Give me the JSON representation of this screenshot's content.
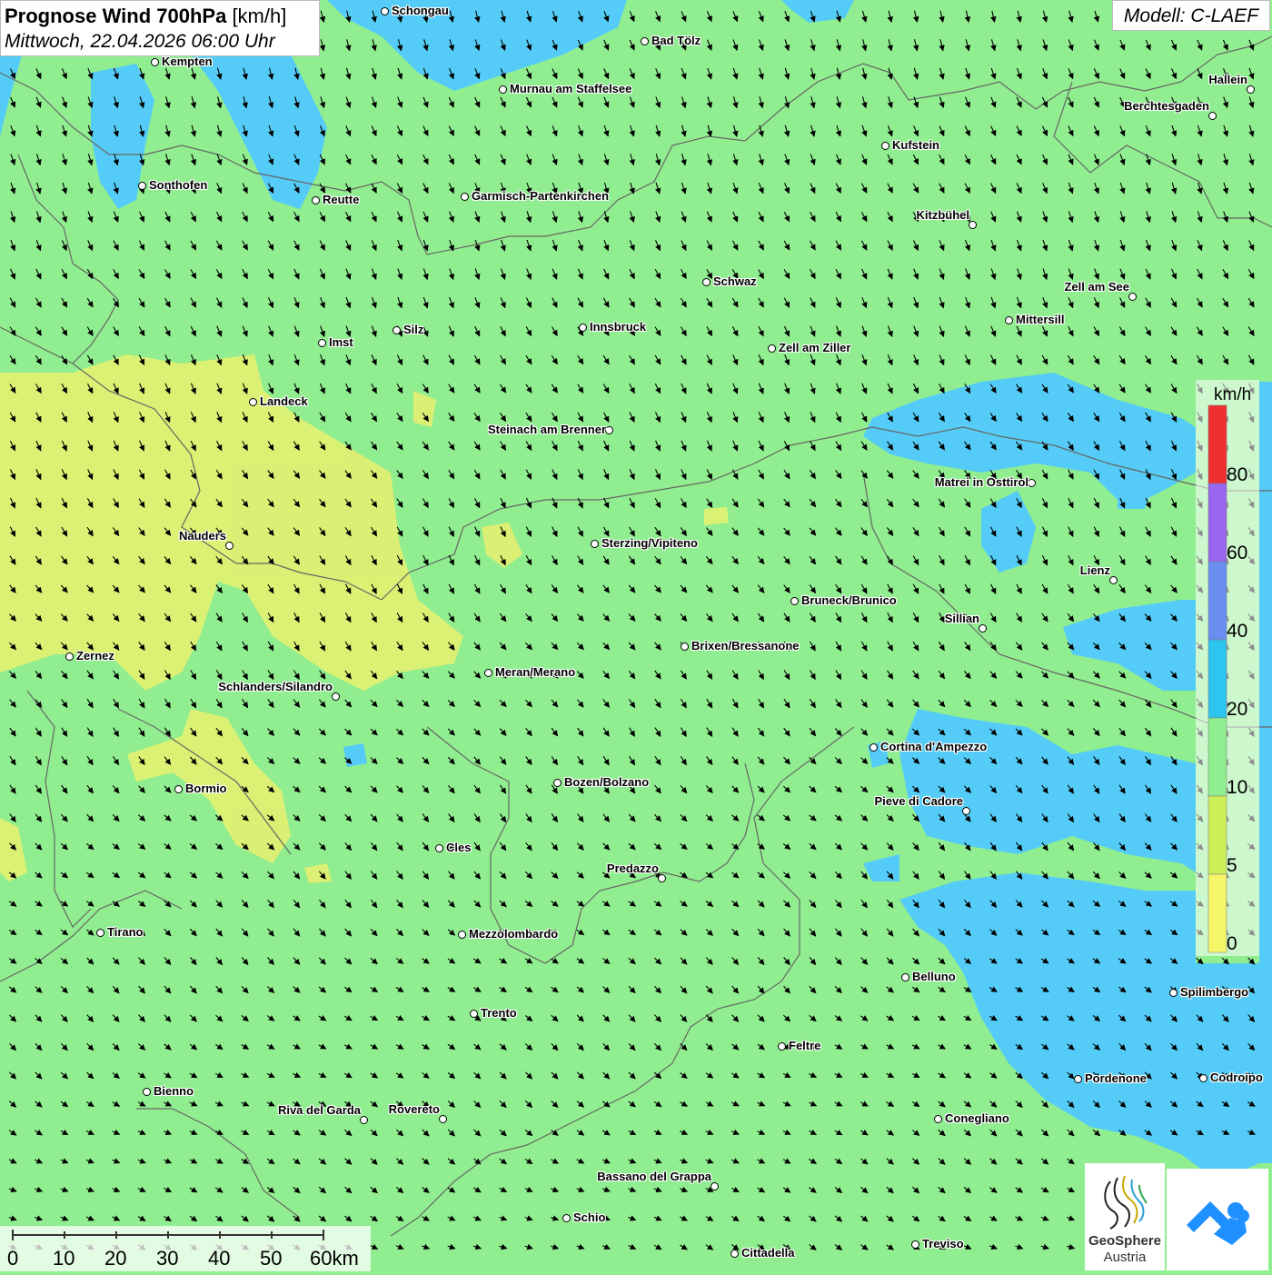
{
  "title": {
    "bold": "Prognose Wind 700hPa",
    "unit": "[km/h]",
    "datetime": "Mittwoch, 22.04.2026 06:00 Uhr"
  },
  "model": "Modell: C-LAEF",
  "colors": {
    "speed_0_5": "#f5f56a",
    "speed_5_10": "#cdef5a",
    "speed_10_20": "#90ee90",
    "speed_20_40": "#55ccf7",
    "speed_40_60": "#6a8ef0",
    "speed_60_80": "#9966ee",
    "speed_80_plus": "#f03030",
    "border_line": "#666666"
  },
  "legend": {
    "unit": "km/h",
    "labels": [
      "0",
      "5",
      "10",
      "20",
      "40",
      "60",
      "80"
    ]
  },
  "scale": {
    "labels": [
      "0",
      "10",
      "20",
      "30",
      "40",
      "50",
      "60km"
    ]
  },
  "logo": {
    "line1": "GeoSphere",
    "line2": "Austria"
  },
  "cities": [
    {
      "name": "Schongau"
    },
    {
      "name": "Bad Tölz"
    },
    {
      "name": "Kempten"
    },
    {
      "name": "Murnau am Staffelsee"
    },
    {
      "name": "Hallein"
    },
    {
      "name": "Berchtesgaden"
    },
    {
      "name": "Kufstein"
    },
    {
      "name": "Sonthofen"
    },
    {
      "name": "Reutte"
    },
    {
      "name": "Garmisch-Partenkirchen"
    },
    {
      "name": "Kitzbühel"
    },
    {
      "name": "Schwaz"
    },
    {
      "name": "Zell am See"
    },
    {
      "name": "Mittersill"
    },
    {
      "name": "Silz"
    },
    {
      "name": "Innsbruck"
    },
    {
      "name": "Imst"
    },
    {
      "name": "Zell am Ziller"
    },
    {
      "name": "Landeck"
    },
    {
      "name": "Steinach am Brenner"
    },
    {
      "name": "Matrei in Osttirol"
    },
    {
      "name": "Nauders"
    },
    {
      "name": "Sterzing/Vipiteno"
    },
    {
      "name": "Lienz"
    },
    {
      "name": "Bruneck/Brunico"
    },
    {
      "name": "Sillian"
    },
    {
      "name": "Brixen/Bressanone"
    },
    {
      "name": "Zernez"
    },
    {
      "name": "Meran/Merano"
    },
    {
      "name": "Schlanders/Silandro"
    },
    {
      "name": "Cortina d'Ampezzo"
    },
    {
      "name": "Bozen/Bolzano"
    },
    {
      "name": "Bormio"
    },
    {
      "name": "Pieve di Cadore"
    },
    {
      "name": "Cles"
    },
    {
      "name": "Predazzo"
    },
    {
      "name": "Tirano"
    },
    {
      "name": "Mezzolombardo"
    },
    {
      "name": "Belluno"
    },
    {
      "name": "Spilimbergo"
    },
    {
      "name": "Trento"
    },
    {
      "name": "Feltre"
    },
    {
      "name": "Bienno"
    },
    {
      "name": "Pordenone"
    },
    {
      "name": "Codroipo"
    },
    {
      "name": "Riva del Garda"
    },
    {
      "name": "Rovereto"
    },
    {
      "name": "Conegliano"
    },
    {
      "name": "Bassano del Grappa"
    },
    {
      "name": "Schio"
    },
    {
      "name": "Cittadella"
    },
    {
      "name": "Treviso"
    }
  ]
}
